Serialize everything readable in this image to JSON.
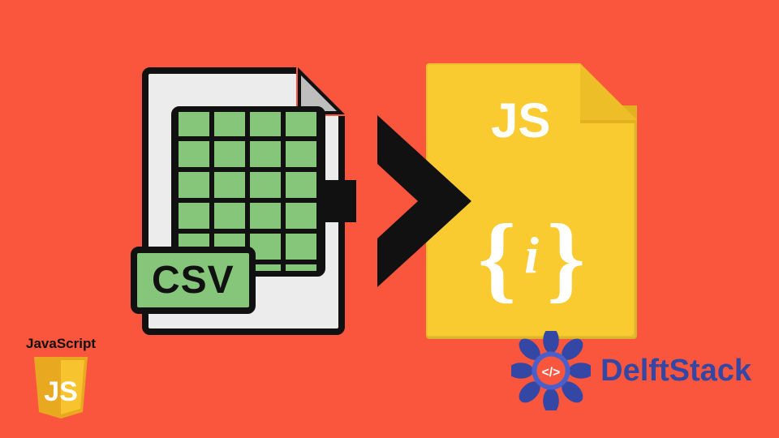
{
  "colors": {
    "background": "#F9563D",
    "csv_page": "#ECECEC",
    "csv_sheet": "#86C67A",
    "csv_sheet_light": "#B1DE9C",
    "outline": "#111111",
    "js_page": "#FACB31",
    "js_fold": "#EDBE28",
    "white": "#FFFFFF",
    "delft_blue": "#3547A4"
  },
  "csv": {
    "badge_text": "CSV"
  },
  "arrow": {
    "name": "arrow-right"
  },
  "js_file": {
    "label": "JS",
    "curly_open": "{",
    "semicolon": "i",
    "curly_close": "}"
  },
  "bottom_left": {
    "title": "JavaScript",
    "shield_text": "JS"
  },
  "bottom_right": {
    "brand": "DelftStack",
    "mandala_glyph": "</>"
  }
}
